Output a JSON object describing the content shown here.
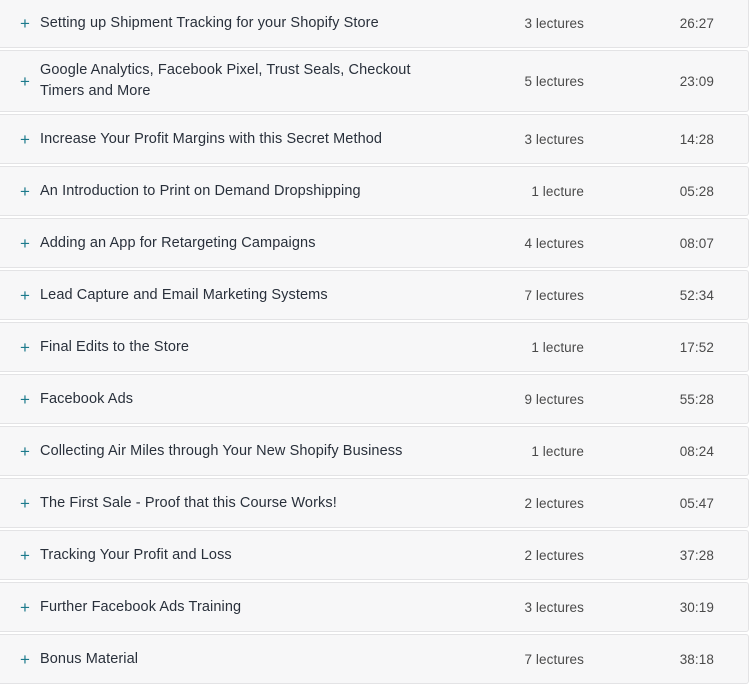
{
  "accent_color": "#1c7a8c",
  "title_color": "#29303b",
  "meta_color": "#4a4a4a",
  "row_background": "#f7f7f8",
  "row_border_color": "#e3e3e5",
  "toggle_icon": {
    "name": "plus-icon",
    "glyph": "+"
  },
  "curriculum": {
    "sections": [
      {
        "title": "Setting up Shipment Tracking for your Shopify Store",
        "lectures": "3 lectures",
        "duration": "26:27",
        "two_line": false
      },
      {
        "title": "Google Analytics, Facebook Pixel, Trust Seals, Checkout Timers and More",
        "lectures": "5 lectures",
        "duration": "23:09",
        "two_line": true
      },
      {
        "title": "Increase Your Profit Margins with this Secret Method",
        "lectures": "3 lectures",
        "duration": "14:28",
        "two_line": false
      },
      {
        "title": "An Introduction to Print on Demand Dropshipping",
        "lectures": "1 lecture",
        "duration": "05:28",
        "two_line": false
      },
      {
        "title": "Adding an App for Retargeting Campaigns",
        "lectures": "4 lectures",
        "duration": "08:07",
        "two_line": false
      },
      {
        "title": "Lead Capture and Email Marketing Systems",
        "lectures": "7 lectures",
        "duration": "52:34",
        "two_line": false
      },
      {
        "title": "Final Edits to the Store",
        "lectures": "1 lecture",
        "duration": "17:52",
        "two_line": false
      },
      {
        "title": "Facebook Ads",
        "lectures": "9 lectures",
        "duration": "55:28",
        "two_line": false
      },
      {
        "title": "Collecting Air Miles through Your New Shopify Business",
        "lectures": "1 lecture",
        "duration": "08:24",
        "two_line": false
      },
      {
        "title": "The First Sale - Proof that this Course Works!",
        "lectures": "2 lectures",
        "duration": "05:47",
        "two_line": false
      },
      {
        "title": "Tracking Your Profit and Loss",
        "lectures": "2 lectures",
        "duration": "37:28",
        "two_line": false
      },
      {
        "title": "Further Facebook Ads Training",
        "lectures": "3 lectures",
        "duration": "30:19",
        "two_line": false
      },
      {
        "title": "Bonus Material",
        "lectures": "7 lectures",
        "duration": "38:18",
        "two_line": false
      }
    ]
  }
}
